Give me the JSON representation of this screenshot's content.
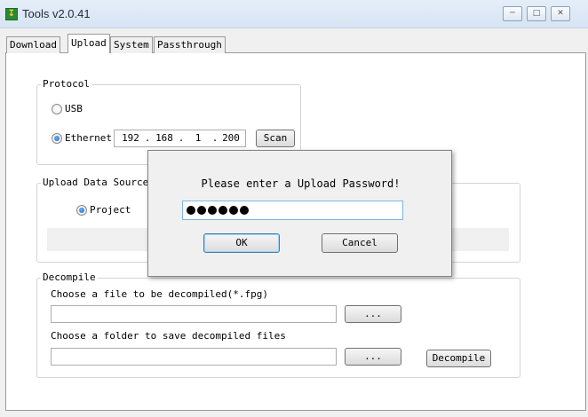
{
  "window": {
    "title": "Tools v2.0.41"
  },
  "tabs": [
    {
      "label": "Download"
    },
    {
      "label": "Upload"
    },
    {
      "label": "System"
    },
    {
      "label": "Passthrough"
    }
  ],
  "protocol": {
    "legend": "Protocol",
    "usb_label": "USB",
    "ethernet_label": "Ethernet",
    "ip": [
      "192",
      "168",
      "1",
      "200"
    ],
    "scan_label": "Scan"
  },
  "upload_source": {
    "legend": "Upload Data Source",
    "project_label": "Project"
  },
  "decompile": {
    "legend": "Decompile",
    "file_label": "Choose a file to be decompiled(*.fpg)",
    "file_value": "",
    "browse_label": "...",
    "folder_label": "Choose a folder to save decompiled files",
    "folder_value": "",
    "browse2_label": "...",
    "decompile_label": "Decompile"
  },
  "dialog": {
    "message": "Please enter a Upload Password!",
    "password_length": 6,
    "ok_label": "OK",
    "cancel_label": "Cancel"
  }
}
